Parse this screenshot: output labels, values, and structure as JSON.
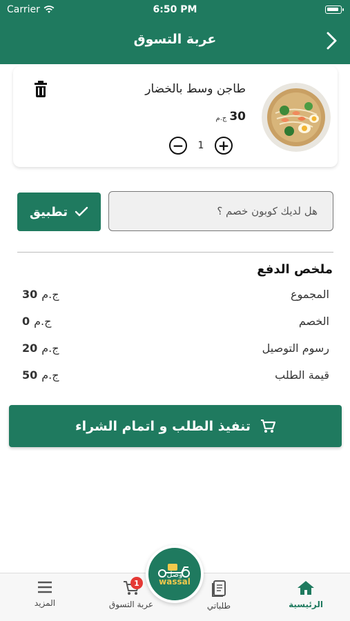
{
  "status_bar": {
    "carrier": "Carrier",
    "time": "6:50 PM"
  },
  "header": {
    "title": "عربة التسوق"
  },
  "cart_item": {
    "name": "طاجن وسط بالخضار",
    "price": "30",
    "currency": "ج.م",
    "quantity": "1",
    "minus_symbol": "−",
    "plus_symbol": "+"
  },
  "coupon": {
    "placeholder": "هل لديك كوبون خصم ؟",
    "value": "",
    "apply_label": "تطبيق"
  },
  "summary": {
    "title": "ملخص الدفع",
    "rows": [
      {
        "label": "المجموع",
        "value": "30",
        "currency": "ج.م"
      },
      {
        "label": "الخصم",
        "value": "0",
        "currency": "ج.م"
      },
      {
        "label": "رسوم التوصيل",
        "value": "20",
        "currency": "ج.م"
      },
      {
        "label": "قيمة الطلب",
        "value": "50",
        "currency": "ج.م"
      }
    ]
  },
  "checkout": {
    "label": "تنفيذ الطلب و اتمام الشراء"
  },
  "tabs": [
    {
      "label": "الرئيسية",
      "icon": "home-icon",
      "active": true
    },
    {
      "label": "طلباتي",
      "icon": "orders-icon"
    },
    {
      "label": "عربة التسوق",
      "icon": "cart-icon",
      "badge": "1"
    },
    {
      "label": "المزيد",
      "icon": "menu-icon"
    }
  ],
  "logo": {
    "text_ar": "وصل",
    "text_en": "wassal"
  },
  "colors": {
    "primary": "#1f7a5f",
    "badge": "#e53935",
    "logo_accent": "#f2c94c"
  }
}
